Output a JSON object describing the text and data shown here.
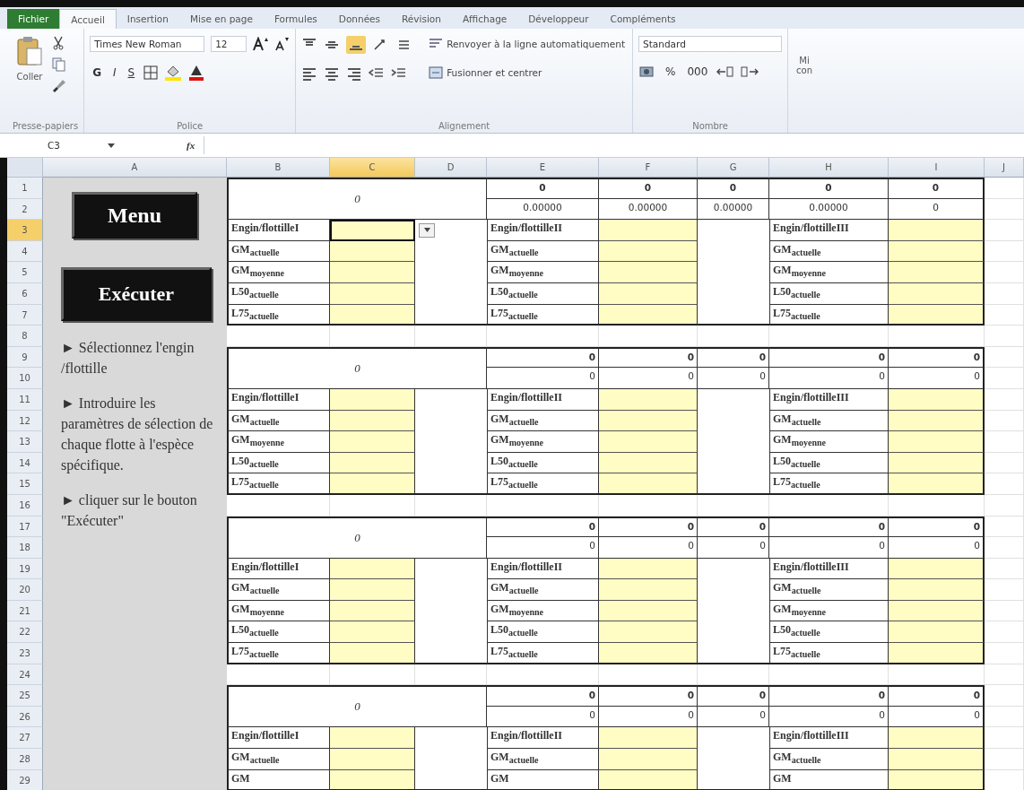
{
  "ribbon": {
    "tabs": [
      {
        "label": "Fichier",
        "kind": "file",
        "selected": false
      },
      {
        "label": "Accueil",
        "kind": "tab",
        "selected": true
      },
      {
        "label": "Insertion",
        "kind": "tab",
        "selected": false
      },
      {
        "label": "Mise en page",
        "kind": "tab",
        "selected": false
      },
      {
        "label": "Formules",
        "kind": "tab",
        "selected": false
      },
      {
        "label": "Données",
        "kind": "tab",
        "selected": false
      },
      {
        "label": "Révision",
        "kind": "tab",
        "selected": false
      },
      {
        "label": "Affichage",
        "kind": "tab",
        "selected": false
      },
      {
        "label": "Développeur",
        "kind": "tab",
        "selected": false
      },
      {
        "label": "Compléments",
        "kind": "tab",
        "selected": false
      }
    ],
    "clipboard": {
      "paste_label": "Coller",
      "group_label": "Presse-papiers"
    },
    "font": {
      "family": "Times New Roman",
      "size": "12",
      "bold_key": "G",
      "italic_key": "I",
      "underline_key": "S",
      "group_label": "Police"
    },
    "alignment": {
      "wrap_label": "Renvoyer à la ligne automatiquement",
      "merge_label": "Fusionner et centrer",
      "group_label": "Alignement"
    },
    "number": {
      "format": "Standard",
      "percent": "%",
      "thousands": "000",
      "group_label": "Nombre"
    },
    "styles_cut": [
      "Mi",
      "con"
    ]
  },
  "formula_bar": {
    "name_box": "C3",
    "function_key": "fx"
  },
  "columns": [
    {
      "label": "A",
      "selected": false
    },
    {
      "label": "B",
      "selected": false
    },
    {
      "label": "C",
      "selected": true
    },
    {
      "label": "D",
      "selected": false
    },
    {
      "label": "E",
      "selected": false
    },
    {
      "label": "F",
      "selected": false
    },
    {
      "label": "G",
      "selected": false
    },
    {
      "label": "H",
      "selected": false
    },
    {
      "label": "I",
      "selected": false
    },
    {
      "label": "J",
      "selected": false
    }
  ],
  "rows": [
    {
      "label": "1",
      "selected": false
    },
    {
      "label": "2",
      "selected": false
    },
    {
      "label": "3",
      "selected": true
    },
    {
      "label": "4",
      "selected": false
    },
    {
      "label": "5",
      "selected": false
    },
    {
      "label": "6",
      "selected": false
    },
    {
      "label": "7",
      "selected": false
    },
    {
      "label": "8",
      "selected": false
    },
    {
      "label": "9",
      "selected": false
    },
    {
      "label": "10",
      "selected": false
    },
    {
      "label": "11",
      "selected": false
    },
    {
      "label": "12",
      "selected": false
    },
    {
      "label": "13",
      "selected": false
    },
    {
      "label": "14",
      "selected": false
    },
    {
      "label": "15",
      "selected": false
    },
    {
      "label": "16",
      "selected": false
    },
    {
      "label": "17",
      "selected": false
    },
    {
      "label": "18",
      "selected": false
    },
    {
      "label": "19",
      "selected": false
    },
    {
      "label": "20",
      "selected": false
    },
    {
      "label": "21",
      "selected": false
    },
    {
      "label": "22",
      "selected": false
    },
    {
      "label": "23",
      "selected": false
    },
    {
      "label": "24",
      "selected": false
    },
    {
      "label": "25",
      "selected": false
    },
    {
      "label": "26",
      "selected": false
    },
    {
      "label": "27",
      "selected": false
    },
    {
      "label": "28",
      "selected": false
    },
    {
      "label": "29",
      "selected": false
    }
  ],
  "side_panel": {
    "buttons": [
      "Menu",
      "Exécuter"
    ],
    "steps": [
      {
        "marker": "►",
        "text": "Sélectionnez l'engin /flottille"
      },
      {
        "marker": "►",
        "text": "Introduire les paramètres  de sélection de chaque flotte à l'espèce spécifique."
      },
      {
        "marker": "►",
        "text": "cliquer sur le bouton \"Exécuter\""
      }
    ]
  },
  "blocks": [
    {
      "title": "0",
      "numbers_centered": true,
      "validation_dropdown": true,
      "top_values": [
        "0",
        "0",
        "0",
        "0",
        "0"
      ],
      "bottom_values": [
        "0.00000",
        "0.00000",
        "0.00000",
        "0.00000",
        "0"
      ],
      "tables": [
        {
          "rows": [
            {
              "label": "Engin/flottilleI",
              "selected": true
            },
            {
              "label": "GM$_{actuelle}$",
              "selected": false
            },
            {
              "label": "GM$_{moyenne}$",
              "selected": false
            },
            {
              "label": "L50$_{actuelle}$",
              "selected": false
            },
            {
              "label": "L75$_{actuelle}$",
              "selected": false
            }
          ]
        },
        {
          "rows": [
            {
              "label": "Engin/flottilleII",
              "selected": false
            },
            {
              "label": "GM$_{actuelle}$",
              "selected": false
            },
            {
              "label": "GM$_{moyenne}$",
              "selected": false
            },
            {
              "label": "L50$_{actuelle}$",
              "selected": false
            },
            {
              "label": "L75$_{actuelle}$",
              "selected": false
            }
          ]
        },
        {
          "rows": [
            {
              "label": "Engin/flottilleIII",
              "selected": false
            },
            {
              "label": "GM$_{actuelle}$",
              "selected": false
            },
            {
              "label": "GM$_{moyenne}$",
              "selected": false
            },
            {
              "label": "L50$_{actuelle}$",
              "selected": false
            },
            {
              "label": "L75$_{actuelle}$",
              "selected": false
            }
          ]
        }
      ]
    },
    {
      "title": "0",
      "numbers_centered": false,
      "validation_dropdown": false,
      "top_values": [
        "0",
        "0",
        "0",
        "0",
        "0"
      ],
      "bottom_values": [
        "0",
        "0",
        "0",
        "0",
        "0"
      ],
      "tables": [
        {
          "rows": [
            {
              "label": "Engin/flottilleI",
              "selected": false
            },
            {
              "label": "GM$_{actuelle}$",
              "selected": false
            },
            {
              "label": "GM$_{moyenne}$",
              "selected": false
            },
            {
              "label": "L50$_{actuelle}$",
              "selected": false
            },
            {
              "label": "L75$_{actuelle}$",
              "selected": false
            }
          ]
        },
        {
          "rows": [
            {
              "label": "Engin/flottilleII",
              "selected": false
            },
            {
              "label": "GM$_{actuelle}$",
              "selected": false
            },
            {
              "label": "GM$_{moyenne}$",
              "selected": false
            },
            {
              "label": "L50$_{actuelle}$",
              "selected": false
            },
            {
              "label": "L75$_{actuelle}$",
              "selected": false
            }
          ]
        },
        {
          "rows": [
            {
              "label": "Engin/flottilleIII",
              "selected": false
            },
            {
              "label": "GM$_{actuelle}$",
              "selected": false
            },
            {
              "label": "GM$_{moyenne}$",
              "selected": false
            },
            {
              "label": "L50$_{actuelle}$",
              "selected": false
            },
            {
              "label": "L75$_{actuelle}$",
              "selected": false
            }
          ]
        }
      ]
    },
    {
      "title": "0",
      "numbers_centered": false,
      "validation_dropdown": false,
      "top_values": [
        "0",
        "0",
        "0",
        "0",
        "0"
      ],
      "bottom_values": [
        "0",
        "0",
        "0",
        "0",
        "0"
      ],
      "tables": [
        {
          "rows": [
            {
              "label": "Engin/flottilleI",
              "selected": false
            },
            {
              "label": "GM$_{actuelle}$",
              "selected": false
            },
            {
              "label": "GM$_{moyenne}$",
              "selected": false
            },
            {
              "label": "L50$_{actuelle}$",
              "selected": false
            },
            {
              "label": "L75$_{actuelle}$",
              "selected": false
            }
          ]
        },
        {
          "rows": [
            {
              "label": "Engin/flottilleII",
              "selected": false
            },
            {
              "label": "GM$_{actuelle}$",
              "selected": false
            },
            {
              "label": "GM$_{moyenne}$",
              "selected": false
            },
            {
              "label": "L50$_{actuelle}$",
              "selected": false
            },
            {
              "label": "L75$_{actuelle}$",
              "selected": false
            }
          ]
        },
        {
          "rows": [
            {
              "label": "Engin/flottilleIII",
              "selected": false
            },
            {
              "label": "GM$_{actuelle}$",
              "selected": false
            },
            {
              "label": "GM$_{moyenne}$",
              "selected": false
            },
            {
              "label": "L50$_{actuelle}$",
              "selected": false
            },
            {
              "label": "L75$_{actuelle}$",
              "selected": false
            }
          ]
        }
      ]
    },
    {
      "title": "0",
      "numbers_centered": false,
      "validation_dropdown": false,
      "top_values": [
        "0",
        "0",
        "0",
        "0",
        "0"
      ],
      "bottom_values": [
        "0",
        "0",
        "0",
        "0",
        "0"
      ],
      "tables": [
        {
          "rows": [
            {
              "label": "Engin/flottilleI",
              "selected": false
            },
            {
              "label": "GM$_{actuelle}$",
              "selected": false
            },
            {
              "label": "GM",
              "selected": false
            }
          ]
        },
        {
          "rows": [
            {
              "label": "Engin/flottilleII",
              "selected": false
            },
            {
              "label": "GM$_{actuelle}$",
              "selected": false
            },
            {
              "label": "GM",
              "selected": false
            }
          ]
        },
        {
          "rows": [
            {
              "label": "Engin/flottilleIII",
              "selected": false
            },
            {
              "label": "GM$_{actuelle}$",
              "selected": false
            },
            {
              "label": "GM",
              "selected": false
            }
          ]
        }
      ]
    }
  ]
}
